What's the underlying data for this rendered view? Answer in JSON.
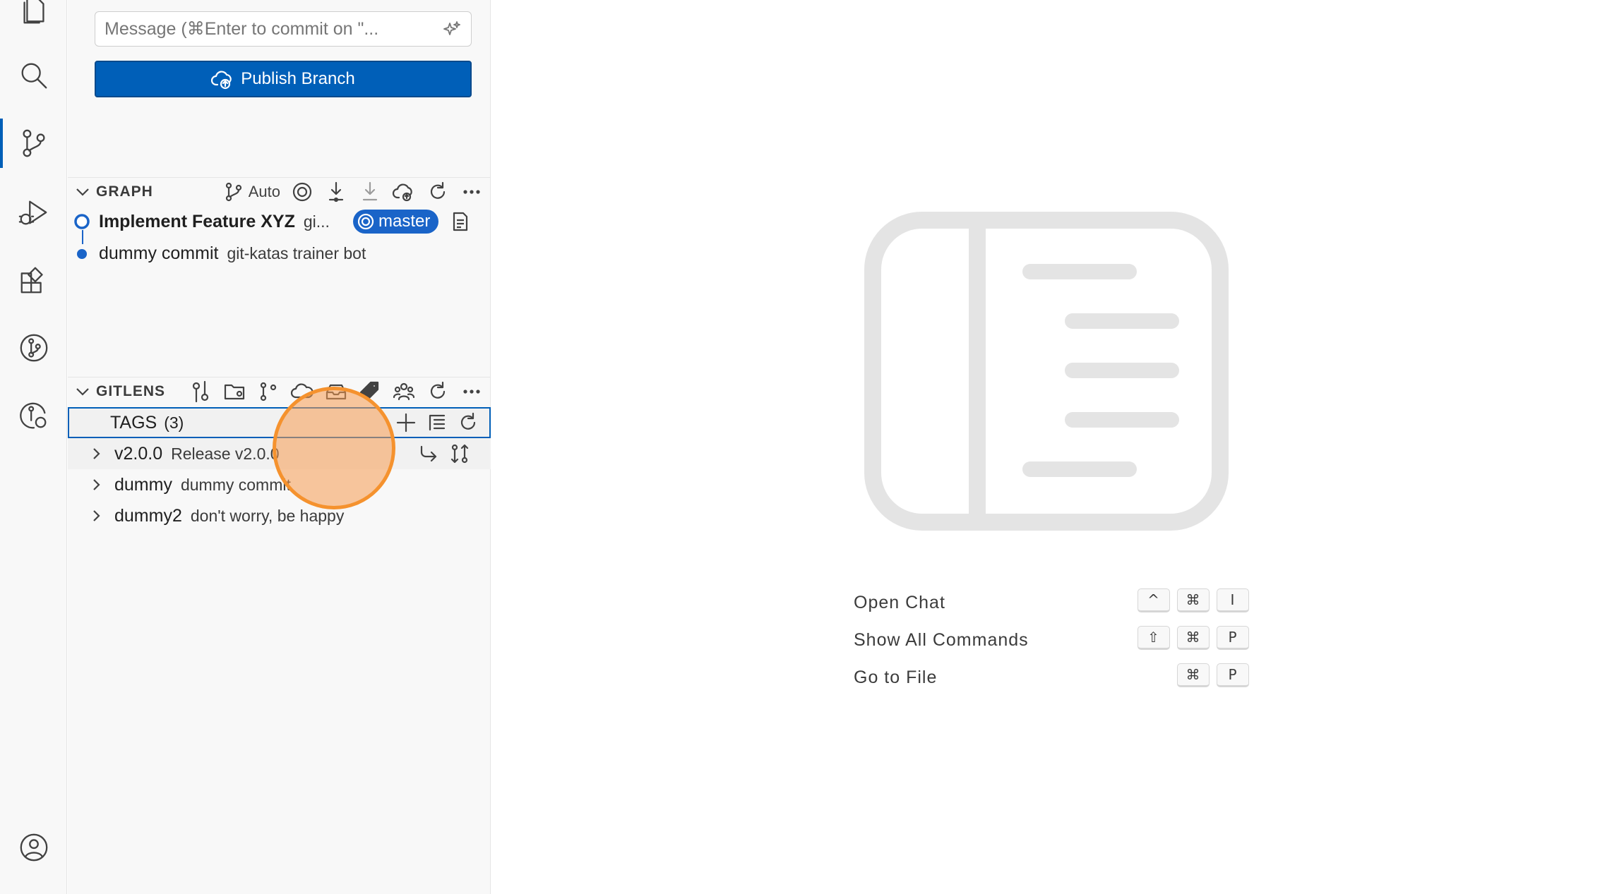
{
  "activity_bar": {
    "icons": [
      "explorer-icon",
      "search-icon",
      "source-control-icon",
      "run-debug-icon",
      "extensions-icon",
      "gitlens-icon",
      "gitlens-inspect-icon",
      "accounts-icon"
    ],
    "accent": "#005fb8"
  },
  "scm": {
    "message_placeholder": "Message (⌘Enter to commit on \"...",
    "publish_label": "Publish Branch",
    "button_color": "#005fb8"
  },
  "graph": {
    "title": "GRAPH",
    "auto_label": "Auto",
    "commits": [
      {
        "title": "Implement Feature XYZ",
        "author": "gi...",
        "branch": "master"
      },
      {
        "title": "dummy commit",
        "author": "git-katas trainer bot"
      }
    ]
  },
  "gitlens": {
    "title": "GITLENS",
    "tags_label": "TAGS",
    "tags_count": "(3)",
    "tags": [
      {
        "name": "v2.0.0",
        "message": "Release v2.0.0"
      },
      {
        "name": "dummy",
        "message": "dummy commit"
      },
      {
        "name": "dummy2",
        "message": "don't worry, be happy"
      }
    ]
  },
  "editor": {
    "shortcuts": [
      {
        "label": "Open Chat",
        "keys": [
          "^",
          "⌘",
          "I"
        ]
      },
      {
        "label": "Show All Commands",
        "keys": [
          "⇧",
          "⌘",
          "P"
        ]
      },
      {
        "label": "Go to File",
        "keys": [
          "⌘",
          "P"
        ]
      }
    ]
  }
}
